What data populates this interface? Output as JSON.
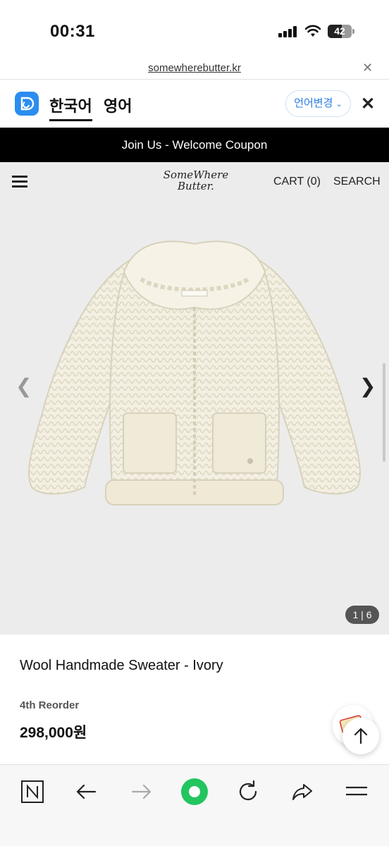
{
  "status_bar": {
    "time": "00:31",
    "battery": "42"
  },
  "url_bar": {
    "url": "somewherebutter.kr",
    "close_icon": "close-icon"
  },
  "translate_bar": {
    "tabs": [
      {
        "label": "한국어",
        "active": true
      },
      {
        "label": "영어",
        "active": false
      }
    ],
    "change_label": "언어변경",
    "close_icon": "close-icon"
  },
  "promo": {
    "text": "Join Us - Welcome Coupon"
  },
  "header": {
    "logo_line1": "SomeWhere",
    "logo_line2": "Butter.",
    "cart_label": "CART (0)",
    "search_label": "SEARCH"
  },
  "gallery": {
    "counter": "1 | 6",
    "image_alt": "ivory knit sweater"
  },
  "product": {
    "title": "Wool Handmade Sweater - Ivory",
    "subtitle": "4th Reorder",
    "price": "298,000원"
  },
  "colors": {
    "accent": "#2b8df0",
    "promo_bg": "#000000",
    "header_bg": "#ececec",
    "green": "#22c55e"
  }
}
